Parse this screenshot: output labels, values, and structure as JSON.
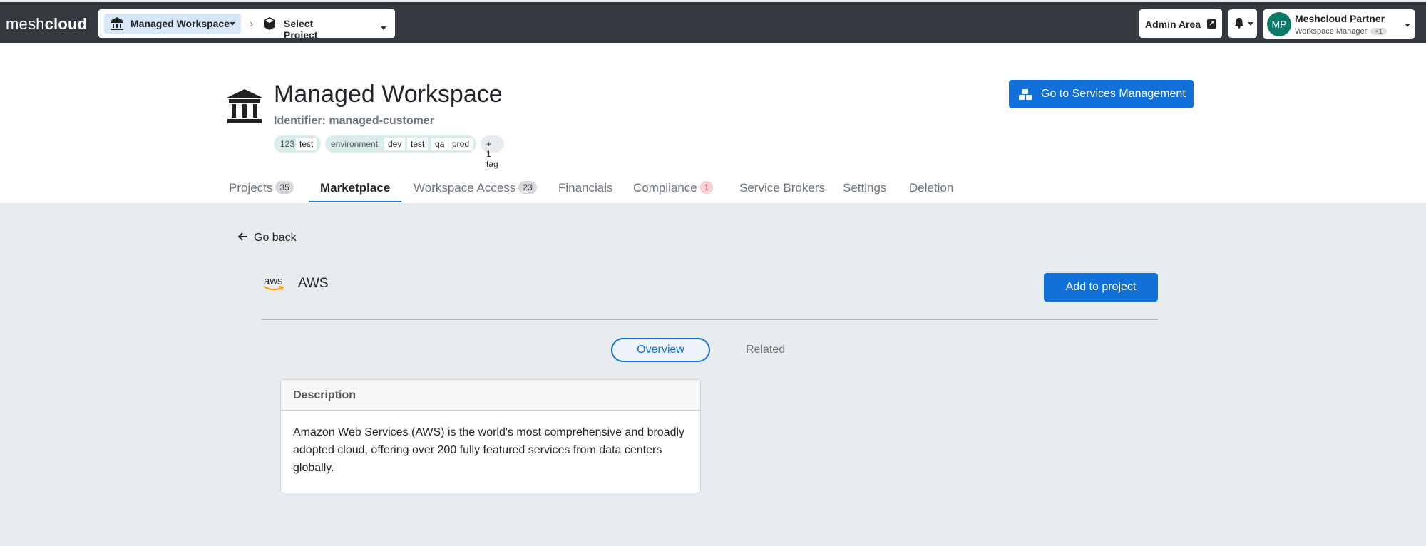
{
  "navbar": {
    "brand_light": "mesh",
    "brand_bold": "cloud",
    "workspace_label": "Managed Workspace",
    "separator": "›",
    "project_label": "Select Project",
    "admin_label": "Admin Area",
    "user_initials": "MP",
    "user_name": "Meshcloud Partner",
    "user_role": "Workspace Manager",
    "user_role_extra": "+1"
  },
  "header": {
    "title": "Managed Workspace",
    "identifier_prefix": "Identifier: ",
    "identifier": "managed-customer",
    "tags": [
      {
        "key": "123",
        "values": [
          "test"
        ]
      },
      {
        "key": "environment",
        "values": [
          "dev",
          "test",
          "qa",
          "prod"
        ]
      }
    ],
    "more_tags": "+ 1 tag",
    "services_button": "Go to Services Management"
  },
  "tabs": [
    {
      "label": "Projects",
      "count": "35"
    },
    {
      "label": "Marketplace",
      "count": ""
    },
    {
      "label": "Workspace Access",
      "count": "23"
    },
    {
      "label": "Financials",
      "count": ""
    },
    {
      "label": "Compliance",
      "count": "1"
    },
    {
      "label": "Service Brokers",
      "count": ""
    },
    {
      "label": "Settings",
      "count": ""
    },
    {
      "label": "Deletion",
      "count": ""
    }
  ],
  "active_tab": "Marketplace",
  "main": {
    "go_back": "Go back",
    "logo_text": "aws",
    "service_title": "AWS",
    "add_button": "Add to project",
    "subtabs": {
      "overview": "Overview",
      "related": "Related"
    },
    "card_title": "Description",
    "card_body": "Amazon Web Services (AWS) is the world's most comprehensive and broadly adopted cloud, offering over 200 fully featured services from data centers globally."
  },
  "colors": {
    "primary": "#1271d9",
    "navbar": "#343a40",
    "main_bg": "#e9ecef",
    "avatar": "#0b7a6b"
  }
}
